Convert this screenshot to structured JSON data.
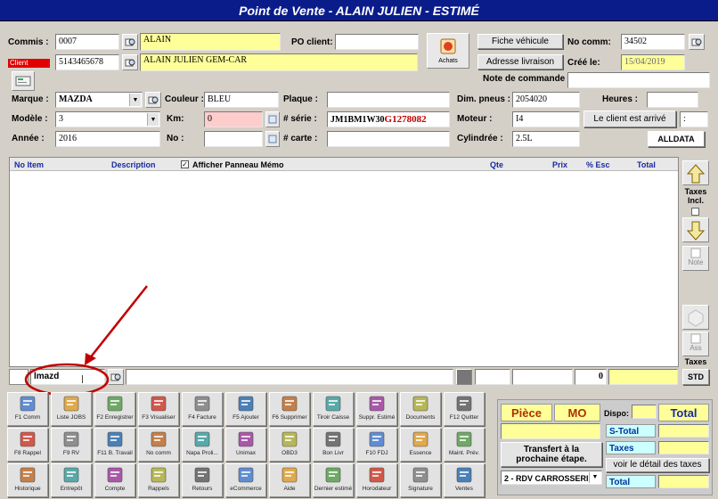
{
  "window": {
    "title": "Point de Vente - ALAIN JULIEN - ESTIMÉ"
  },
  "header": {
    "commis_label": "Commis :",
    "commis_value": "0007",
    "commis_name": "ALAIN",
    "client_label": "Client",
    "client_value": "5143465678",
    "client_name": "ALAIN JULIEN GEM-CAR",
    "po_label": "PO client:",
    "po_value": "",
    "achats_label": "Achats",
    "fiche_vehicule": "Fiche véhicule",
    "adresse_livraison": "Adresse livraison",
    "no_comm_label": "No comm:",
    "no_comm_value": "34502",
    "cree_le_label": "Créé le:",
    "cree_le_value": "15/04/2019",
    "note_commande_label": "Note de commande"
  },
  "vehicle": {
    "marque_label": "Marque :",
    "marque_value": "MAZDA",
    "couleur_label": "Couleur :",
    "couleur_value": "BLEU",
    "plaque_label": "Plaque :",
    "plaque_value": "",
    "dim_pneus_label": "Dim. pneus :",
    "dim_pneus_value": "2054020",
    "heures_label": "Heures :",
    "heures_value": "",
    "modele_label": "Modèle :",
    "modele_value": "3",
    "km_label": "Km:",
    "km_value": "0",
    "serie_label": "# série :",
    "serie_value_a": "JM1BM1W30",
    "serie_value_b": "G1278082",
    "moteur_label": "Moteur :",
    "moteur_value": "I4",
    "client_arrive": "Le client est arrivé",
    "client_arrive_extra": ":",
    "annee_label": "Année :",
    "annee_value": "2016",
    "no_label": "No :",
    "no_value": "",
    "carte_label": "# carte :",
    "carte_value": "",
    "cylindree_label": "Cylindrée :",
    "cylindree_value": "2.5L",
    "alldata": "ALLDATA"
  },
  "grid": {
    "columns": [
      "No Item",
      "Description",
      "Qte",
      "Prix",
      "% Esc",
      "Total"
    ],
    "memo_label": "Afficher Panneau Mémo",
    "memo_checked": true,
    "search_value": "lmazd",
    "bottom_qty": "0"
  },
  "right_panel": {
    "taxes_incl": "Taxes Incl.",
    "note": "Note",
    "ass": "Ass",
    "taxes": "Taxes",
    "std": "STD"
  },
  "toolbar": {
    "row1": [
      "F1 Comm",
      "Liste JOBS",
      "F2 Enregistrer",
      "F3 Visualiser",
      "F4 Facture",
      "F5 Ajouter",
      "F6 Supprimer",
      "Tiroir Caisse",
      "Suppr. Estimé",
      "Documents",
      "F12 Quitter"
    ],
    "row2": [
      "F8 Rappel",
      "F9 RV",
      "F11 B. Travail",
      "No comm",
      "Napa Proli...",
      "Unimax",
      "OBD3",
      "Bon Livr",
      "F10 FDJ",
      "Essence",
      "Maint. Prév."
    ],
    "row3": [
      "Historique",
      "Entrepôt",
      "Compte",
      "Rappels",
      "Retours",
      "eCommerce",
      "Aide",
      "Dernier estimé",
      "Horodateur",
      "Signature",
      "Ventes"
    ]
  },
  "summary": {
    "piece": "Pièce",
    "mo": "MO",
    "dispo": "Dispo:",
    "total_head": "Total",
    "transfert": "Transfert à la prochaine étape.",
    "s_total": "S-Total",
    "taxes": "Taxes",
    "etape_select": "2 - RDV CARROSSERIE",
    "voir_detail": "voir le détail des taxes",
    "total": "Total"
  },
  "colors": {
    "title_bar": "#0a1c8a",
    "highlight_yellow": "#ffff99",
    "annotation_red": "#c00000"
  }
}
